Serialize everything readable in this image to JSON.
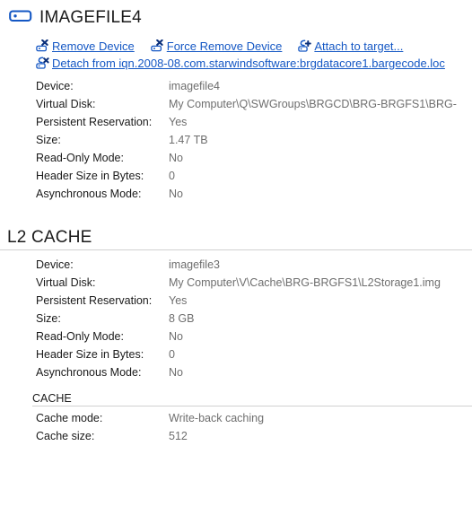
{
  "header": {
    "icon": "device-icon",
    "title": "IMAGEFILE4"
  },
  "actions": [
    {
      "icon": "remove-device-icon",
      "label": "Remove Device"
    },
    {
      "icon": "force-remove-device-icon",
      "label": "Force Remove Device"
    },
    {
      "icon": "attach-to-target-icon",
      "label": "Attach to target..."
    },
    {
      "icon": "detach-from-target-icon",
      "label": "Detach from iqn.2008-08.com.starwindsoftware:brgdatacore1.bargecode.loc"
    }
  ],
  "device_properties": {
    "rows": [
      {
        "label": "Device:",
        "value": "imagefile4"
      },
      {
        "label": "Virtual Disk:",
        "value": "My Computer\\Q\\SWGroups\\BRGCD\\BRG-BRGFS1\\BRG-"
      },
      {
        "label": "Persistent Reservation:",
        "value": "Yes"
      },
      {
        "label": "Size:",
        "value": "1.47 TB"
      },
      {
        "label": "Read-Only Mode:",
        "value": "No"
      },
      {
        "label": "Header Size in Bytes:",
        "value": "0"
      },
      {
        "label": "Asynchronous Mode:",
        "value": "No"
      }
    ]
  },
  "l2_cache": {
    "heading": "L2 CACHE",
    "rows": [
      {
        "label": "Device:",
        "value": "imagefile3"
      },
      {
        "label": "Virtual Disk:",
        "value": "My Computer\\V\\Cache\\BRG-BRGFS1\\L2Storage1.img"
      },
      {
        "label": "Persistent Reservation:",
        "value": "Yes"
      },
      {
        "label": "Size:",
        "value": "8 GB"
      },
      {
        "label": "Read-Only Mode:",
        "value": "No"
      },
      {
        "label": "Header Size in Bytes:",
        "value": "0"
      },
      {
        "label": "Asynchronous Mode:",
        "value": "No"
      }
    ],
    "cache": {
      "heading": "CACHE",
      "rows": [
        {
          "label": "Cache mode:",
          "value": "Write-back caching"
        },
        {
          "label": "Cache size:",
          "value": "512"
        }
      ]
    }
  },
  "colors": {
    "link": "#1457c4",
    "icon_blue": "#1457c4",
    "label_text": "#1a1a1a",
    "value_text": "#6e6e6e",
    "rule": "#d0d0d0",
    "background": "#ffffff"
  }
}
